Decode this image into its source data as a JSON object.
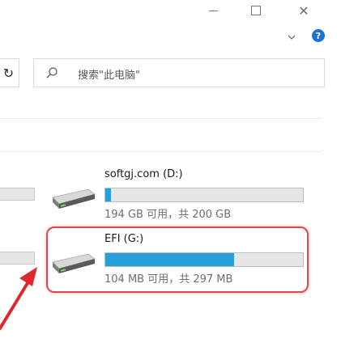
{
  "window": {
    "minimize_icon": "minimize-icon",
    "maximize_icon": "maximize-icon",
    "close_icon": "close-icon",
    "close_glyph": "✕"
  },
  "ribbon": {
    "expand_icon": "chevron-down-icon",
    "help_glyph": "?"
  },
  "toolbar": {
    "refresh_glyph": "↻",
    "search_placeholder": "搜索\"此电脑\""
  },
  "drives": [
    {
      "name": "softgj.com (D:)",
      "info": "194 GB 可用，共 200 GB",
      "used_fraction": 0.03,
      "highlighted": false
    },
    {
      "name": "EFI (G:)",
      "info": "104 MB 可用，共 297 MB",
      "used_fraction": 0.65,
      "highlighted": true
    }
  ],
  "colors": {
    "usage_bar": "#26a0da",
    "highlight": "#e0484e",
    "help": "#1a73d9"
  }
}
